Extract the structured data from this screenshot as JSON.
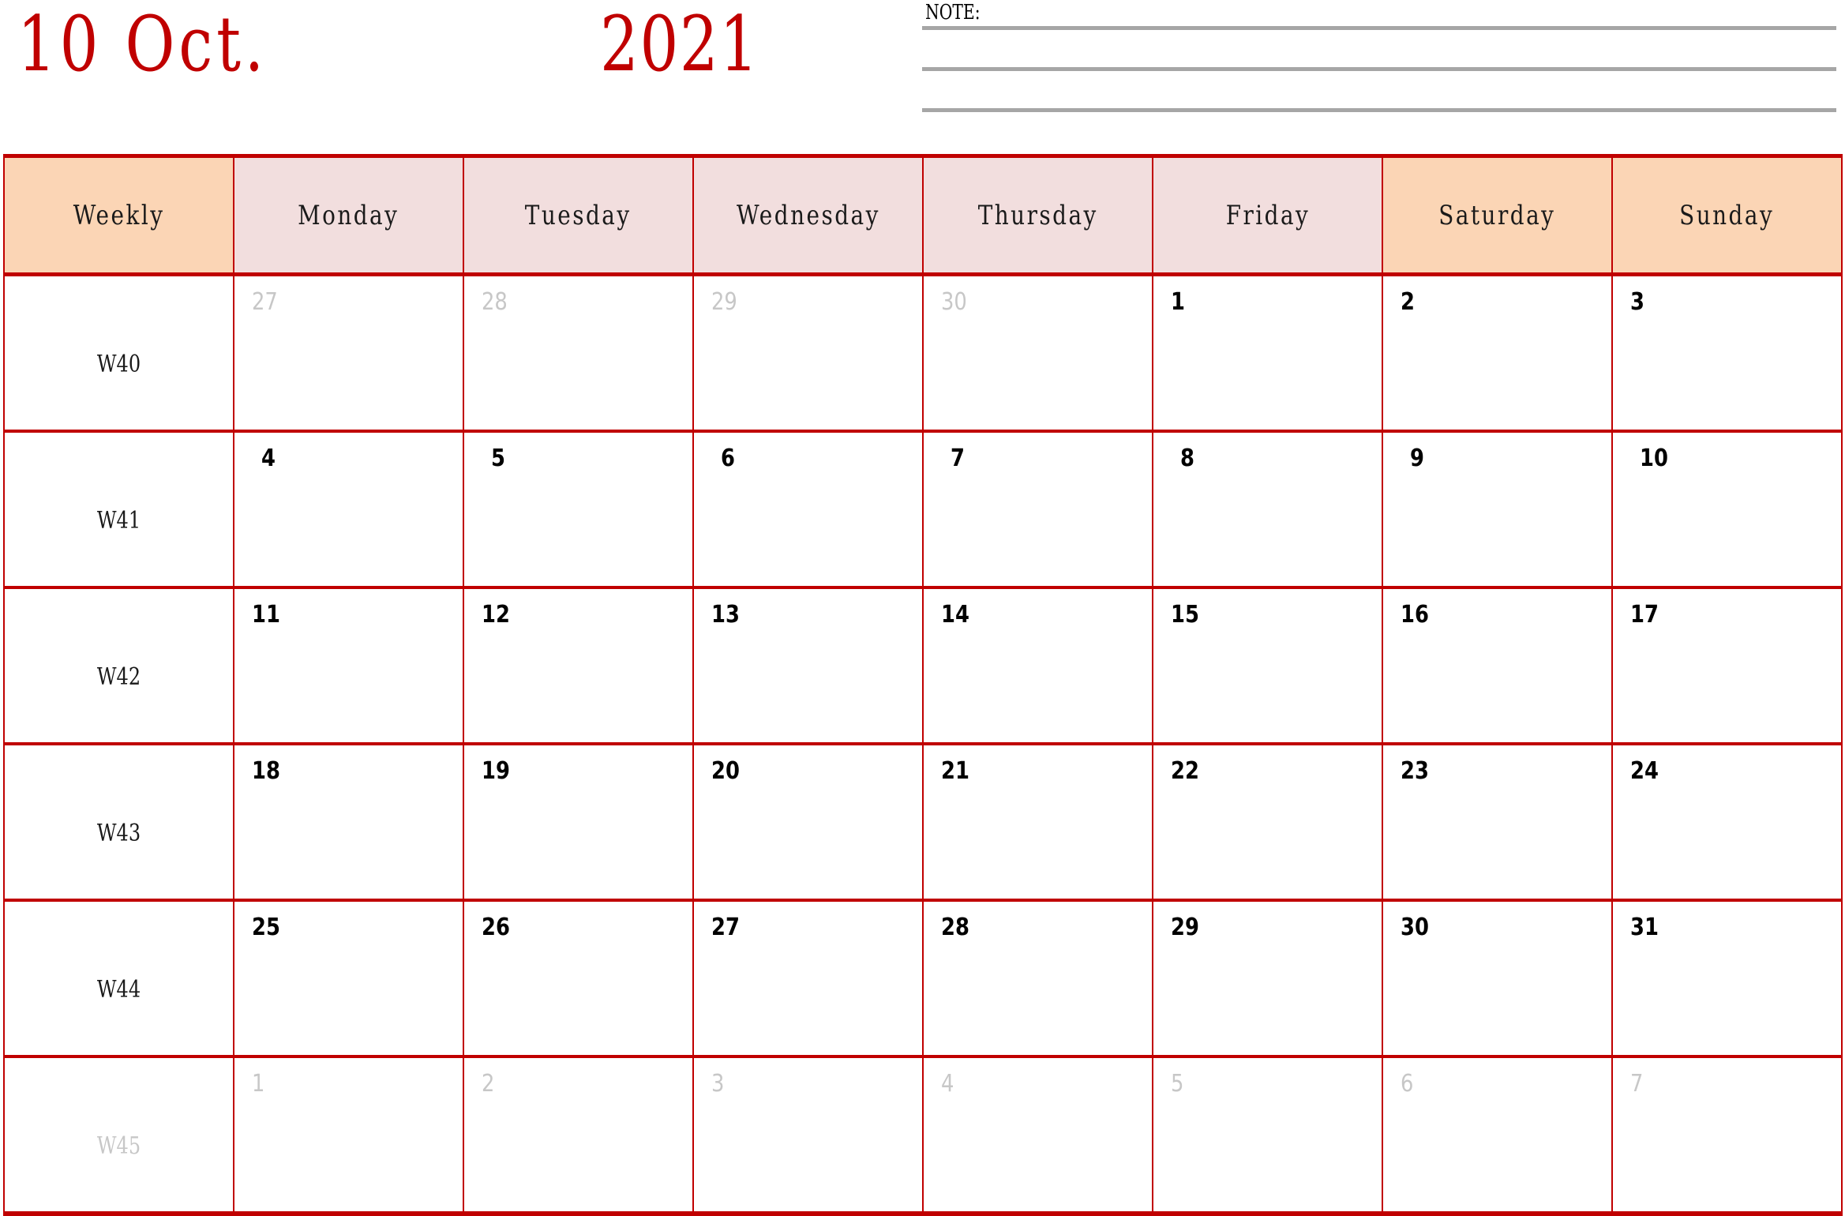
{
  "header": {
    "month_title": "10 Oct.",
    "year_title": "2021",
    "accent_color": "#C00000",
    "note": {
      "label": "NOTE:",
      "line_color": "#A6A6A6",
      "line_count": 3
    }
  },
  "calendar": {
    "colors": {
      "grid_line": "#C00000",
      "header_weekend_bg": "#FBD5B5",
      "header_weekday_bg": "#F2DEDE",
      "muted_text": "#C7C7C7",
      "active_text": "#000000"
    },
    "columns": [
      {
        "key": "weekly",
        "label": "Weekly",
        "type": "week"
      },
      {
        "key": "monday",
        "label": "Monday",
        "type": "weekday"
      },
      {
        "key": "tuesday",
        "label": "Tuesday",
        "type": "weekday"
      },
      {
        "key": "wednesday",
        "label": "Wednesday",
        "type": "weekday"
      },
      {
        "key": "thursday",
        "label": "Thursday",
        "type": "weekday"
      },
      {
        "key": "friday",
        "label": "Friday",
        "type": "weekday"
      },
      {
        "key": "saturday",
        "label": "Saturday",
        "type": "weekend"
      },
      {
        "key": "sunday",
        "label": "Sunday",
        "type": "weekend"
      }
    ],
    "rows": [
      {
        "week": "W40",
        "week_muted": false,
        "days": [
          {
            "num": "27",
            "muted": true
          },
          {
            "num": "28",
            "muted": true
          },
          {
            "num": "29",
            "muted": true
          },
          {
            "num": "30",
            "muted": true
          },
          {
            "num": "1",
            "muted": false
          },
          {
            "num": "2",
            "muted": false
          },
          {
            "num": "3",
            "muted": false
          }
        ]
      },
      {
        "week": "W41",
        "week_muted": false,
        "days": [
          {
            "num": "4",
            "muted": false
          },
          {
            "num": "5",
            "muted": false
          },
          {
            "num": "6",
            "muted": false
          },
          {
            "num": "7",
            "muted": false
          },
          {
            "num": "8",
            "muted": false
          },
          {
            "num": "9",
            "muted": false
          },
          {
            "num": "10",
            "muted": false
          }
        ]
      },
      {
        "week": "W42",
        "week_muted": false,
        "days": [
          {
            "num": "11",
            "muted": false
          },
          {
            "num": "12",
            "muted": false
          },
          {
            "num": "13",
            "muted": false
          },
          {
            "num": "14",
            "muted": false
          },
          {
            "num": "15",
            "muted": false
          },
          {
            "num": "16",
            "muted": false
          },
          {
            "num": "17",
            "muted": false
          }
        ]
      },
      {
        "week": "W43",
        "week_muted": false,
        "days": [
          {
            "num": "18",
            "muted": false
          },
          {
            "num": "19",
            "muted": false
          },
          {
            "num": "20",
            "muted": false
          },
          {
            "num": "21",
            "muted": false
          },
          {
            "num": "22",
            "muted": false
          },
          {
            "num": "23",
            "muted": false
          },
          {
            "num": "24",
            "muted": false
          }
        ]
      },
      {
        "week": "W44",
        "week_muted": false,
        "days": [
          {
            "num": "25",
            "muted": false
          },
          {
            "num": "26",
            "muted": false
          },
          {
            "num": "27",
            "muted": false
          },
          {
            "num": "28",
            "muted": false
          },
          {
            "num": "29",
            "muted": false
          },
          {
            "num": "30",
            "muted": false
          },
          {
            "num": "31",
            "muted": false
          }
        ]
      },
      {
        "week": "W45",
        "week_muted": true,
        "days": [
          {
            "num": "1",
            "muted": true
          },
          {
            "num": "2",
            "muted": true
          },
          {
            "num": "3",
            "muted": true
          },
          {
            "num": "4",
            "muted": true
          },
          {
            "num": "5",
            "muted": true
          },
          {
            "num": "6",
            "muted": true
          },
          {
            "num": "7",
            "muted": true
          }
        ]
      }
    ]
  }
}
